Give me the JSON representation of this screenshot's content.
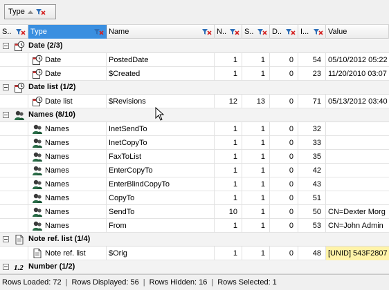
{
  "group_by": {
    "chip_label": "Type"
  },
  "columns": [
    {
      "key": "s",
      "label": "S.."
    },
    {
      "key": "type",
      "label": "Type"
    },
    {
      "key": "name",
      "label": "Name"
    },
    {
      "key": "n",
      "label": "N.."
    },
    {
      "key": "s2",
      "label": "S.."
    },
    {
      "key": "d",
      "label": "D.."
    },
    {
      "key": "i",
      "label": "I..."
    },
    {
      "key": "value",
      "label": "Value"
    }
  ],
  "groups": [
    {
      "label": "Date (2/3)",
      "icon": "clock-calendar-icon",
      "rows": [
        {
          "type": "Date",
          "name": "PostedDate",
          "n": "1",
          "s": "1",
          "d": "0",
          "i": "54",
          "value": "05/10/2012 05:22"
        },
        {
          "type": "Date",
          "name": "$Created",
          "n": "1",
          "s": "1",
          "d": "0",
          "i": "23",
          "value": "11/20/2010 03:07"
        }
      ]
    },
    {
      "label": "Date list (1/2)",
      "icon": "clock-calendar-icon",
      "rows": [
        {
          "type": "Date list",
          "name": "$Revisions",
          "n": "12",
          "s": "13",
          "d": "0",
          "i": "71",
          "value": "05/13/2012 03:40"
        }
      ]
    },
    {
      "label": "Names (8/10)",
      "icon": "person-names-icon",
      "rows": [
        {
          "type": "Names",
          "name": "InetSendTo",
          "n": "1",
          "s": "1",
          "d": "0",
          "i": "32",
          "value": ""
        },
        {
          "type": "Names",
          "name": "InetCopyTo",
          "n": "1",
          "s": "1",
          "d": "0",
          "i": "33",
          "value": ""
        },
        {
          "type": "Names",
          "name": "FaxToList",
          "n": "1",
          "s": "1",
          "d": "0",
          "i": "35",
          "value": ""
        },
        {
          "type": "Names",
          "name": "EnterCopyTo",
          "n": "1",
          "s": "1",
          "d": "0",
          "i": "42",
          "value": ""
        },
        {
          "type": "Names",
          "name": "EnterBlindCopyTo",
          "n": "1",
          "s": "1",
          "d": "0",
          "i": "43",
          "value": ""
        },
        {
          "type": "Names",
          "name": "CopyTo",
          "n": "1",
          "s": "1",
          "d": "0",
          "i": "51",
          "value": ""
        },
        {
          "type": "Names",
          "name": "SendTo",
          "n": "10",
          "s": "1",
          "d": "0",
          "i": "50",
          "value": "CN=Dexter Morg"
        },
        {
          "type": "Names",
          "name": "From",
          "n": "1",
          "s": "1",
          "d": "0",
          "i": "53",
          "value": "CN=John Admin"
        }
      ]
    },
    {
      "label": "Note ref. list (1/4)",
      "icon": "document-icon",
      "rows": [
        {
          "type": "Note ref. list",
          "name": "$Orig",
          "n": "1",
          "s": "1",
          "d": "0",
          "i": "48",
          "value": "[UNID] 543F2807"
        }
      ]
    },
    {
      "label": "Number (1/2)",
      "icon": "number-icon",
      "icon_text": "1.2",
      "rows": []
    }
  ],
  "status": {
    "loaded": "Rows Loaded: 72",
    "displayed": "Rows Displayed: 56",
    "hidden": "Rows Hidden: 16",
    "selected": "Rows Selected: 1",
    "separator": "|"
  },
  "colors": {
    "header_active": "#3a8fe0",
    "value_highlight": "#fff3a8",
    "filter_red": "#d42020"
  }
}
